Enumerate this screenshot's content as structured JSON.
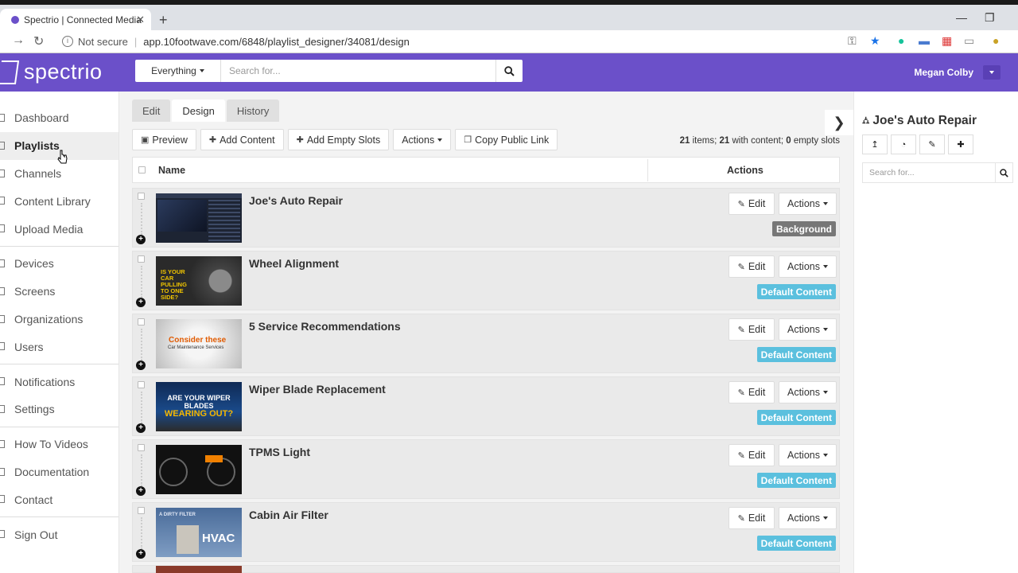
{
  "browser": {
    "tab_title": "Spectrio | Connected Media Netw",
    "security": "Not secure",
    "url": "app.10footwave.com/6848/playlist_designer/34081/design"
  },
  "header": {
    "logo": "spectrio",
    "search_scope": "Everything",
    "search_placeholder": "Search for...",
    "user_name": "Megan Colby"
  },
  "sidebar": {
    "groups": [
      [
        "Dashboard",
        "Playlists",
        "Channels",
        "Content Library",
        "Upload Media"
      ],
      [
        "Devices",
        "Screens",
        "Organizations",
        "Users"
      ],
      [
        "Notifications",
        "Settings"
      ],
      [
        "How To Videos",
        "Documentation",
        "Contact"
      ],
      [
        "Sign Out"
      ]
    ],
    "active": "Playlists"
  },
  "page_tabs": [
    "Edit",
    "Design",
    "History"
  ],
  "active_tab": "Design",
  "toolbar": {
    "preview": "Preview",
    "add_content": "Add Content",
    "add_empty_slots": "Add Empty Slots",
    "actions": "Actions",
    "copy_public_link": "Copy Public Link"
  },
  "counts": {
    "items": "21",
    "items_label": " items; ",
    "with_content": "21",
    "with_content_label": " with content; ",
    "empty": "0",
    "empty_label": " empty slots"
  },
  "table": {
    "col_name": "Name",
    "col_actions": "Actions",
    "edit_label": "Edit",
    "actions_label": "Actions",
    "rows": [
      {
        "title": "Joe's Auto Repair",
        "badge": "Background",
        "badge_color": "#777777",
        "thumb": "dash"
      },
      {
        "title": "Wheel Alignment",
        "badge": "Default Content",
        "badge_color": "#5bc0de",
        "thumb": "wheel"
      },
      {
        "title": "5 Service Recommendations",
        "badge": "Default Content",
        "badge_color": "#5bc0de",
        "thumb": "service"
      },
      {
        "title": "Wiper Blade Replacement",
        "badge": "Default Content",
        "badge_color": "#5bc0de",
        "thumb": "wiper"
      },
      {
        "title": "TPMS Light",
        "badge": "Default Content",
        "badge_color": "#5bc0de",
        "thumb": "tpms"
      },
      {
        "title": "Cabin Air Filter",
        "badge": "Default Content",
        "badge_color": "#5bc0de",
        "thumb": "air"
      }
    ]
  },
  "thumbs": {
    "wheel_text": "IS YOUR CAR PULLING TO ONE SIDE?",
    "service_text1": "Consider these",
    "service_text2": "Car Maintenance Services",
    "wiper_text1": "ARE YOUR WIPER BLADES",
    "wiper_text2": "WEARING OUT?",
    "air_text0": "A DIRTY FILTER",
    "air_text": "HVAC"
  },
  "right_panel": {
    "title": "Joe's Auto Repair",
    "search_placeholder": "Search for..."
  },
  "colors": {
    "brand": "#6b50c9",
    "info": "#5bc0de",
    "default_badge": "#777777"
  }
}
